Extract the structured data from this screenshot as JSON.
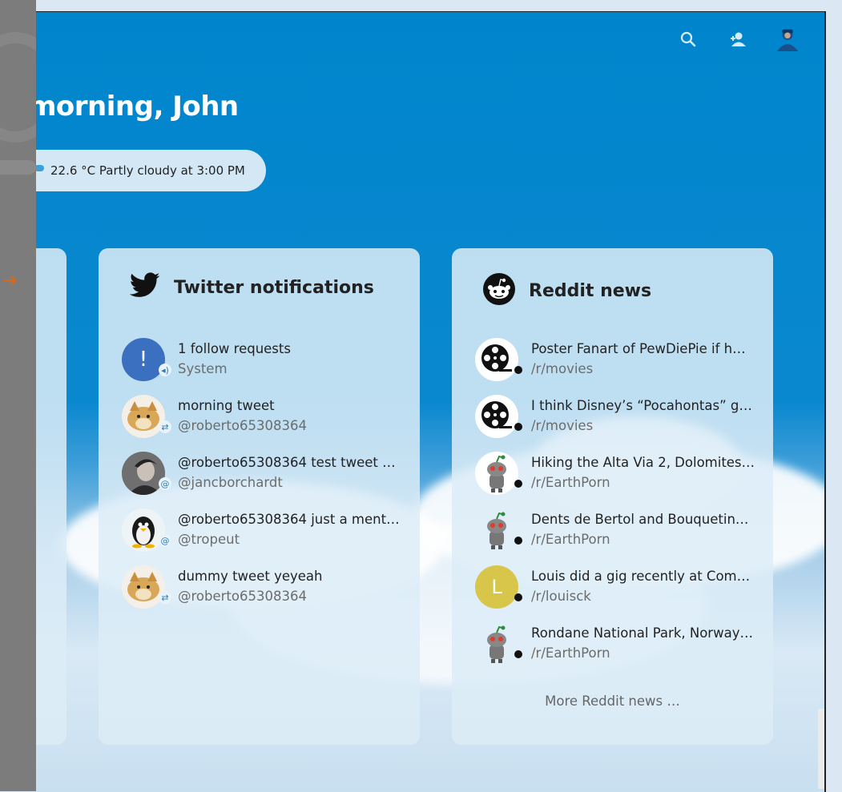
{
  "header": {
    "greeting": "morning, John",
    "weather": "22.6 °C Partly cloudy at 3:00 PM"
  },
  "top_icons": [
    "search-icon",
    "contacts-icon",
    "user-avatar-icon"
  ],
  "twitter": {
    "title": "Twitter notifications",
    "items": [
      {
        "title": "1 follow requests",
        "sub": "System",
        "avatar": "exclamation",
        "badge": "speaker-icon",
        "avatar_text": "!"
      },
      {
        "title": "morning tweet",
        "sub": "@roberto65308364",
        "avatar": "fox",
        "badge": "retweet-icon"
      },
      {
        "title": "@roberto65308364 test tweet …",
        "sub": "@jancborchardt",
        "avatar": "person",
        "badge": "mention-icon"
      },
      {
        "title": "@roberto65308364 just a ment…",
        "sub": "@tropeut",
        "avatar": "penguin",
        "badge": "mention-icon"
      },
      {
        "title": "dummy tweet yeyeah",
        "sub": "@roberto65308364",
        "avatar": "fox",
        "badge": "retweet-icon"
      }
    ]
  },
  "reddit": {
    "title": "Reddit news",
    "more": "More Reddit news …",
    "items": [
      {
        "title": "Poster Fanart of PewDiePie if h…",
        "sub": "/r/movies",
        "avatar": "film"
      },
      {
        "title": "I think Disney’s “Pocahontas” g…",
        "sub": "/r/movies",
        "avatar": "film"
      },
      {
        "title": "Hiking the Alta Via 2, Dolomites…",
        "sub": "/r/EarthPorn",
        "avatar": "robot"
      },
      {
        "title": "Dents de Bertol and Bouquetin…",
        "sub": "/r/EarthPorn",
        "avatar": "robot"
      },
      {
        "title": "Louis did a gig recently at Come…",
        "sub": "/r/louisck",
        "avatar": "letter",
        "avatar_text": "L"
      },
      {
        "title": "Rondane National Park, Norway…",
        "sub": "/r/EarthPorn",
        "avatar": "robot"
      }
    ]
  },
  "colors": {
    "header_blue": "#0085cc",
    "panel_bg": "#dcecf7",
    "exclamation_avatar": "#3b6fbf",
    "letter_avatar": "#d8c64a"
  }
}
